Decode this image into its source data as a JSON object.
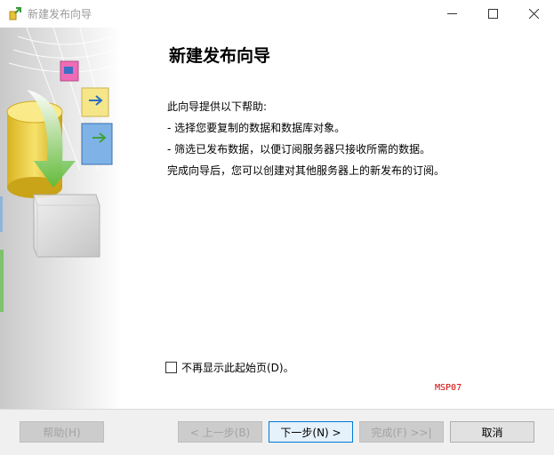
{
  "window": {
    "title": "新建发布向导",
    "controls": {
      "minimize": "minimize-icon",
      "maximize": "maximize-icon",
      "close": "close-icon"
    }
  },
  "page": {
    "heading": "新建发布向导",
    "lines": [
      "此向导提供以下帮助:",
      "- 选择您要复制的数据和数据库对象。",
      "- 筛选已发布数据，以便订阅服务器只接收所需的数据。",
      "完成向导后，您可以创建对其他服务器上的新发布的订阅。"
    ],
    "dont_show_label": "不再显示此起始页(D)。",
    "dont_show_checked": false,
    "server_name": "MSP07"
  },
  "buttons": {
    "help": "帮助(H)",
    "back": "< 上一步(B)",
    "next": "下一步(N) >",
    "finish": "完成(F) >>|",
    "cancel": "取消"
  },
  "colors": {
    "server_text": "#d40000",
    "primary_border": "#0078d7"
  }
}
